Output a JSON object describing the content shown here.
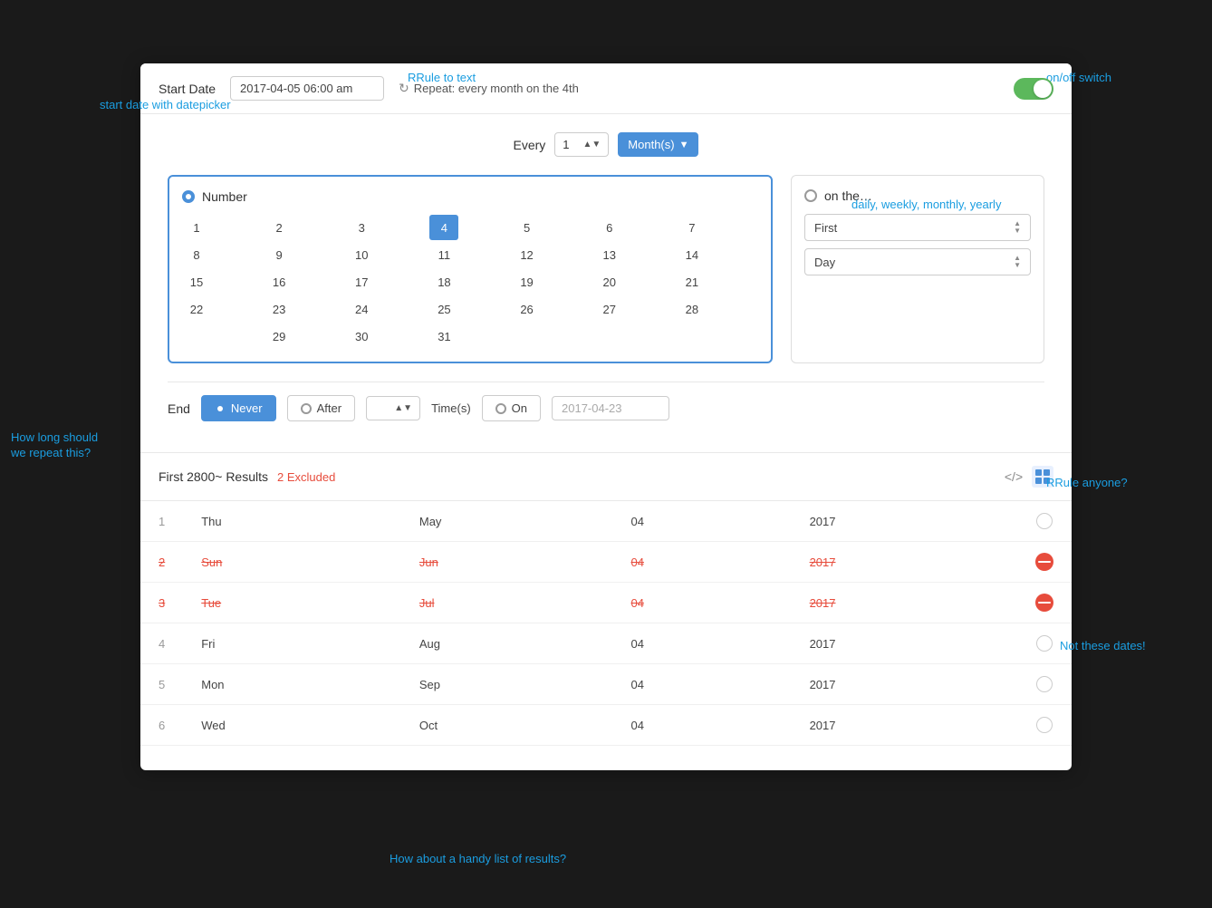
{
  "annotations": {
    "start_date_label": "start date with datepicker",
    "rrule_to_text": "RRule to text",
    "on_off_switch": "on/off switch",
    "daily_weekly": "daily, weekly, monthly, yearly",
    "how_long": "How long should\nwe repeat this?",
    "rrule_anyone": "RRule anyone?",
    "not_these_dates": "Not these dates!",
    "handy_list": "How about a handy list of results?"
  },
  "header": {
    "start_date_label": "Start Date",
    "start_date_value": "2017-04-05 06:00 am",
    "repeat_text": "Repeat: every month on the 4th",
    "toggle_on": true
  },
  "every_row": {
    "label": "Every",
    "number": "1",
    "period": "Month(s)"
  },
  "number_panel": {
    "label": "Number",
    "calendar_days": [
      [
        1,
        2,
        3,
        4,
        5,
        6,
        7
      ],
      [
        8,
        9,
        10,
        11,
        12,
        13,
        14
      ],
      [
        15,
        16,
        17,
        18,
        19,
        20,
        21
      ],
      [
        22,
        23,
        24,
        25,
        26,
        27,
        28
      ],
      [
        null,
        29,
        30,
        31,
        null,
        null,
        null
      ]
    ],
    "selected_day": 4
  },
  "on_the_panel": {
    "label": "on the…",
    "first_value": "First",
    "day_value": "Day"
  },
  "end_row": {
    "label": "End",
    "never_label": "Never",
    "after_label": "After",
    "after_value": "",
    "times_label": "Time(s)",
    "on_label": "On",
    "on_date_placeholder": "2017-04-23"
  },
  "results": {
    "title": "First 2800~ Results",
    "excluded_text": "2 Excluded",
    "rows": [
      {
        "index": "1",
        "day": "Thu",
        "month": "May",
        "date": "04",
        "year": "2017",
        "excluded": false
      },
      {
        "index": "2",
        "day": "Sun",
        "month": "Jun",
        "date": "04",
        "year": "2017",
        "excluded": true
      },
      {
        "index": "3",
        "day": "Tue",
        "month": "Jul",
        "date": "04",
        "year": "2017",
        "excluded": true
      },
      {
        "index": "4",
        "day": "Fri",
        "month": "Aug",
        "date": "04",
        "year": "2017",
        "excluded": false
      },
      {
        "index": "5",
        "day": "Mon",
        "month": "Sep",
        "date": "04",
        "year": "2017",
        "excluded": false
      },
      {
        "index": "6",
        "day": "Wed",
        "month": "Oct",
        "date": "04",
        "year": "2017",
        "excluded": false
      }
    ]
  }
}
